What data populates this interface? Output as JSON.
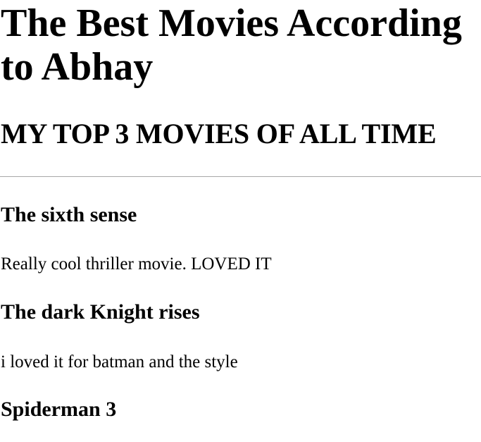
{
  "header": {
    "title": "The Best Movies According to Abhay",
    "subtitle": "MY TOP 3 MOVIES OF ALL TIME"
  },
  "movies": [
    {
      "title": "The sixth sense",
      "description": "Really cool thriller movie. LOVED IT"
    },
    {
      "title": "The dark Knight rises",
      "description": "i loved it for batman and the style"
    },
    {
      "title": "Spiderman 3"
    }
  ],
  "colors": {
    "text": "#000000",
    "background": "#ffffff",
    "divider": "#a8a8a8"
  }
}
